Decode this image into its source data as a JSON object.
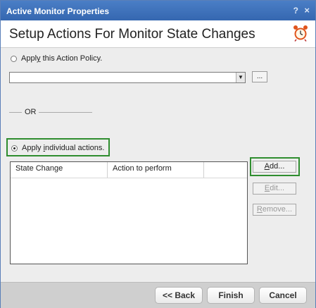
{
  "window": {
    "title": "Active Monitor Properties",
    "help_glyph": "?",
    "close_glyph": "×"
  },
  "header": {
    "title": "Setup Actions For Monitor State Changes",
    "icon": "alarm-clock-icon"
  },
  "policy_option": {
    "label_pre": "Appl",
    "label_u": "y",
    "label_post": " this Action Policy.",
    "selected": false,
    "select_value": "",
    "browse_label": "..."
  },
  "separator": {
    "label": "OR"
  },
  "individual_option": {
    "label_pre": "Apply ",
    "label_u": "i",
    "label_post": "ndividual actions.",
    "selected": true
  },
  "table": {
    "columns": [
      "State Change",
      "Action to perform",
      ""
    ],
    "rows": []
  },
  "side_buttons": {
    "add": {
      "pre": "",
      "u": "A",
      "post": "dd..."
    },
    "edit": {
      "pre": "",
      "u": "E",
      "post": "dit..."
    },
    "remove": {
      "pre": "",
      "u": "R",
      "post": "emove..."
    }
  },
  "footer": {
    "back": "<< Back",
    "finish": "Finish",
    "cancel": "Cancel"
  },
  "colors": {
    "title_bar": "#3a6db5",
    "highlight": "#2f8d2f",
    "alarm_clock": "#e0541c"
  }
}
